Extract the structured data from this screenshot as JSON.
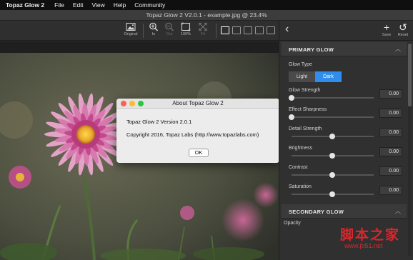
{
  "menubar": {
    "app": "Topaz Glow 2",
    "items": [
      "File",
      "Edit",
      "View",
      "Help",
      "Community"
    ]
  },
  "window": {
    "title": "Topaz Glow 2 V2.0.1 - example.jpg @ 23.4%"
  },
  "toolbar": {
    "original": "Original",
    "zoom_in": "In",
    "zoom_out": "Out",
    "zoom_100": "100%",
    "fit": "Fit"
  },
  "panel": {
    "save": "Save",
    "reset": "Reset",
    "primary_section": "PRIMARY GLOW",
    "glow_type_label": "Glow Type",
    "glow_type_options": [
      "Light",
      "Dark"
    ],
    "glow_type_selected": "Dark",
    "sliders": [
      {
        "label": "Glow Strength",
        "value": "0.00",
        "level": 0.0
      },
      {
        "label": "Effect Sharpness",
        "value": "0.00",
        "level": 0.0
      },
      {
        "label": "Detail Strength",
        "value": "0.00",
        "level": 0.5
      },
      {
        "label": "Brightness",
        "value": "0.00",
        "level": 0.5
      },
      {
        "label": "Contrast",
        "value": "0.00",
        "level": 0.5
      },
      {
        "label": "Saturation",
        "value": "0.00",
        "level": 0.5
      }
    ],
    "secondary_section": "SECONDARY GLOW",
    "opacity_label": "Opacity"
  },
  "dialog": {
    "title": "About Topaz Glow 2",
    "version": "Topaz Glow 2 Version 2.0.1",
    "copyright": "Copyright 2016, Topaz Labs (http://www.topazlabs.com)",
    "ok": "OK"
  },
  "colors": {
    "accent": "#2e8ded",
    "close": "#fc5f57",
    "minimize": "#fdbc2e",
    "zoom": "#28c840"
  },
  "watermark": {
    "text": "脚本之家",
    "url": "www.jb51.net"
  }
}
